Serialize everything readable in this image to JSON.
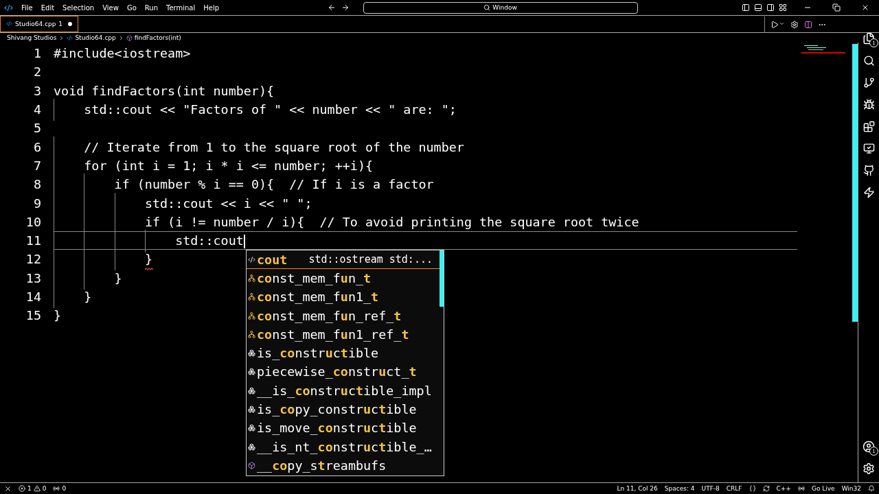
{
  "menu": [
    "File",
    "Edit",
    "Selection",
    "View",
    "Go",
    "Run",
    "Terminal",
    "Help"
  ],
  "command_center": {
    "text": "Window"
  },
  "tabs": [
    {
      "label": "Studio64.cpp",
      "badge": "1",
      "modified": true,
      "selected": true
    }
  ],
  "breadcrumb": [
    "Shivang Studios",
    "Studio64.cpp",
    "findFactors(int)"
  ],
  "editor": {
    "lines": [
      {
        "number": "1",
        "text": "#include<iostream>"
      },
      {
        "number": "2"
      },
      {
        "number": "3",
        "text": "void findFactors(int number){"
      },
      {
        "number": "4",
        "text": "    std::cout << \"Factors of \" << number << \" are: \";"
      },
      {
        "number": "5"
      },
      {
        "number": "6",
        "text": "    // Iterate from 1 to the square root of the number"
      },
      {
        "number": "7",
        "text": "    for (int i = 1; i * i <= number; ++i){"
      },
      {
        "number": "8",
        "text": "        if (number % i == 0){  // If i is a factor"
      },
      {
        "number": "9",
        "text": "            std::cout << i << \" \";"
      },
      {
        "number": "10",
        "text": "            if (i != number / i){  // To avoid printing the square root twice"
      },
      {
        "number": "11",
        "text": "                std::cout",
        "current": true
      },
      {
        "number": "12",
        "text": "            }",
        "error": true
      },
      {
        "number": "13",
        "text": "        }"
      },
      {
        "number": "14",
        "text": "    }"
      },
      {
        "number": "15",
        "text": "}"
      }
    ]
  },
  "suggestions": [
    {
      "kind": "variable",
      "label": "cout",
      "detail": "std::ostream std:...",
      "selected": true
    },
    {
      "kind": "class",
      "label": "**co**nst_mem_f**u**n_**t**",
      "selected": false
    },
    {
      "kind": "class",
      "label": "**co**nst_mem_f**u**n1_**t**",
      "selected": false
    },
    {
      "kind": "class",
      "label": "**co**nst_mem_f**u**n_ref_**t**",
      "selected": false
    },
    {
      "kind": "class",
      "label": "**co**nst_mem_f**u**n1_ref_**t**",
      "selected": false
    },
    {
      "kind": "struct",
      "label": "is_**co**nstr**u**c**t**ible",
      "selected": false
    },
    {
      "kind": "struct",
      "label": "piecewise_**co**nstr**u**ct_**t**",
      "selected": false
    },
    {
      "kind": "struct",
      "label": "__is_**co**nstr**u**c**t**ible_impl",
      "selected": false
    },
    {
      "kind": "struct",
      "label": "is_**co**py_constr**u**c**t**ible",
      "selected": false
    },
    {
      "kind": "struct",
      "label": "is_move_**co**nstr**u**c**t**ible",
      "selected": false
    },
    {
      "kind": "struct",
      "label": "__is_nt_**co**nstr**u**c**t**ible_…",
      "selected": false
    },
    {
      "kind": "function",
      "label": "__**co**py_s**t**reambufs",
      "selected": false
    }
  ],
  "activity_badges": {
    "explorer": "1",
    "accounts": "1"
  },
  "status_bar": {
    "errors": "1",
    "warnings": "0",
    "ports": "0",
    "right": [
      "Ln 11, Col 26",
      "Spaces: 4",
      "UTF-8",
      "CRLF"
    ],
    "language": "C++",
    "go_live": "Go Live",
    "platform": "Win32"
  }
}
